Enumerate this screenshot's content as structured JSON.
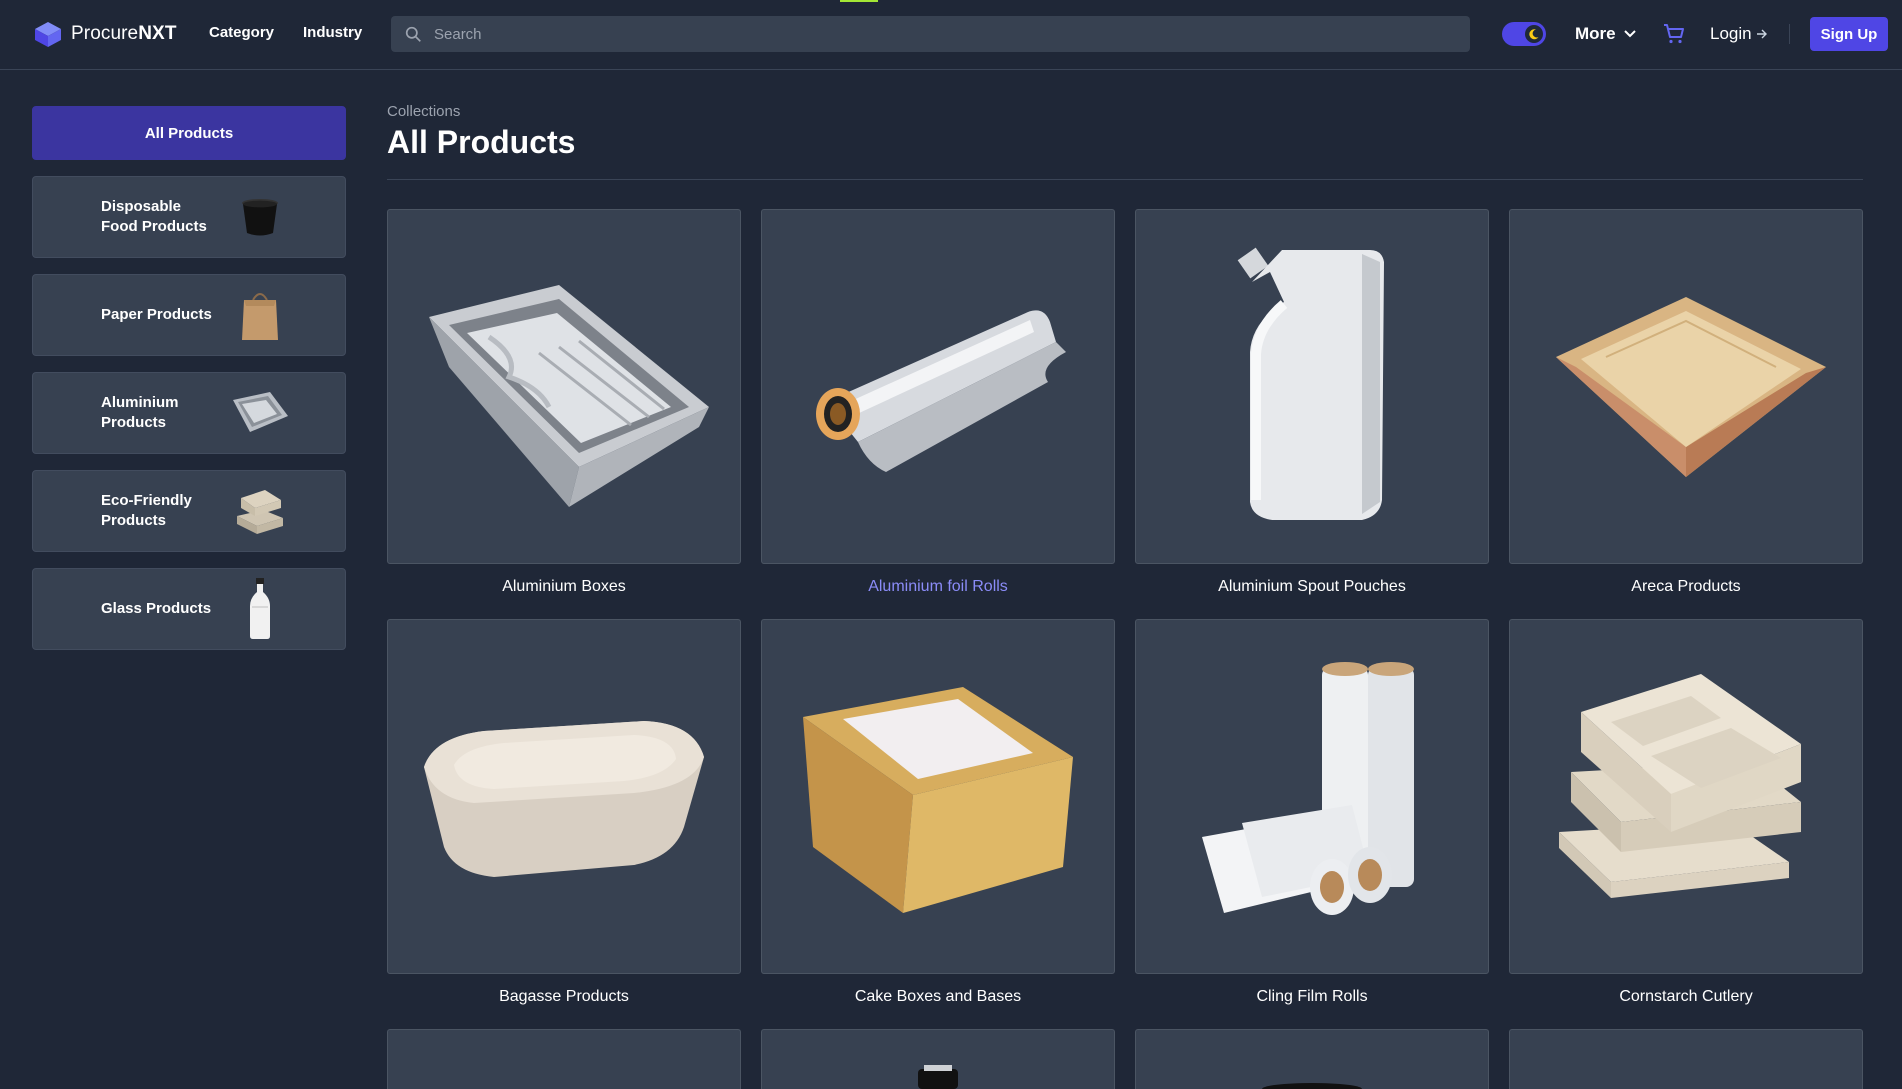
{
  "header": {
    "logo_text_regular": "Procure",
    "logo_text_bold": "NXT",
    "nav": [
      "Category",
      "Industry"
    ],
    "search_placeholder": "Search",
    "more_label": "More",
    "login_label": "Login",
    "signup_label": "Sign Up"
  },
  "sidebar": {
    "items": [
      {
        "label": "All Products",
        "active": true
      },
      {
        "label": "Disposable Food Products",
        "icon": "black-food-container-icon"
      },
      {
        "label": "Paper Products",
        "icon": "paper-bag-icon"
      },
      {
        "label": "Aluminium Products",
        "icon": "aluminium-tray-icon"
      },
      {
        "label": "Eco-Friendly Products",
        "icon": "eco-tray-icon"
      },
      {
        "label": "Glass Products",
        "icon": "glass-bottle-icon"
      }
    ]
  },
  "main": {
    "breadcrumb": "Collections",
    "title": "All Products",
    "products": [
      {
        "name": "Aluminium Boxes",
        "image": "aluminium-box-image"
      },
      {
        "name": "Aluminium foil Rolls",
        "image": "foil-roll-image",
        "highlighted": true
      },
      {
        "name": "Aluminium Spout Pouches",
        "image": "spout-pouch-image"
      },
      {
        "name": "Areca Products",
        "image": "areca-bowl-image"
      },
      {
        "name": "Bagasse Products",
        "image": "bagasse-container-image"
      },
      {
        "name": "Cake Boxes and Bases",
        "image": "cake-box-image"
      },
      {
        "name": "Cling Film Rolls",
        "image": "cling-film-image"
      },
      {
        "name": "Cornstarch Cutlery",
        "image": "cornstarch-tray-image"
      }
    ]
  },
  "colors": {
    "background": "#1f2737",
    "card": "#374151",
    "accent": "#4f46e5",
    "active_sidebar": "#3b35a0",
    "link_highlight": "#8b8cf8"
  }
}
